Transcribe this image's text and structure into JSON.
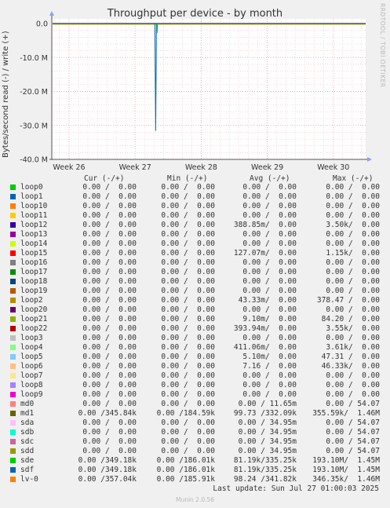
{
  "chart_data": {
    "type": "line",
    "title": "Throughput per device - by month",
    "ylabel": "Bytes/second read (-) / write (+)",
    "ylim": [
      -40000000,
      1000000
    ],
    "y_ticks": [
      {
        "value": 0,
        "label": "0.0"
      },
      {
        "value": -10000000,
        "label": "-10.0 M"
      },
      {
        "value": -20000000,
        "label": "-20.0 M"
      },
      {
        "value": -30000000,
        "label": "-30.0 M"
      },
      {
        "value": -40000000,
        "label": "-40.0 M"
      }
    ],
    "x_ticks": [
      "Week 26",
      "Week 27",
      "Week 28",
      "Week 29",
      "Week 30"
    ],
    "spike": {
      "week_pos": 2.0,
      "min_value": -31600000
    },
    "grid": true
  },
  "side_label": "RRDTOOL / TOBI OETIKER",
  "legend_headers": [
    "Cur (-/+)",
    "Min (-/+)",
    "Avg (-/+)",
    "Max (-/+)"
  ],
  "legend": [
    {
      "name": "loop0",
      "color": "#00cc00",
      "cur": "0.00 /  0.00",
      "min": "0.00 /  0.00",
      "avg": "0.00 /  0.00",
      "max": "0.00 /  0.00"
    },
    {
      "name": "loop1",
      "color": "#0066b3",
      "cur": "0.00 /  0.00",
      "min": "0.00 /  0.00",
      "avg": "0.00 /  0.00",
      "max": "0.00 /  0.00"
    },
    {
      "name": "loop10",
      "color": "#ff8000",
      "cur": "0.00 /  0.00",
      "min": "0.00 /  0.00",
      "avg": "0.00 /  0.00",
      "max": "0.00 /  0.00"
    },
    {
      "name": "loop11",
      "color": "#ffcc00",
      "cur": "0.00 /  0.00",
      "min": "0.00 /  0.00",
      "avg": "0.00 /  0.00",
      "max": "0.00 /  0.00"
    },
    {
      "name": "loop12",
      "color": "#330099",
      "cur": "0.00 /  0.00",
      "min": "0.00 /  0.00",
      "avg": "388.85m/  0.00",
      "max": "3.50k/  0.00"
    },
    {
      "name": "loop13",
      "color": "#990099",
      "cur": "0.00 /  0.00",
      "min": "0.00 /  0.00",
      "avg": "0.00 /  0.00",
      "max": "0.00 /  0.00"
    },
    {
      "name": "loop14",
      "color": "#ccff00",
      "cur": "0.00 /  0.00",
      "min": "0.00 /  0.00",
      "avg": "0.00 /  0.00",
      "max": "0.00 /  0.00"
    },
    {
      "name": "loop15",
      "color": "#ff0000",
      "cur": "0.00 /  0.00",
      "min": "0.00 /  0.00",
      "avg": "127.07m/  0.00",
      "max": "1.15k/  0.00"
    },
    {
      "name": "loop16",
      "color": "#808080",
      "cur": "0.00 /  0.00",
      "min": "0.00 /  0.00",
      "avg": "0.00 /  0.00",
      "max": "0.00 /  0.00"
    },
    {
      "name": "loop17",
      "color": "#008f00",
      "cur": "0.00 /  0.00",
      "min": "0.00 /  0.00",
      "avg": "0.00 /  0.00",
      "max": "0.00 /  0.00"
    },
    {
      "name": "loop18",
      "color": "#00487d",
      "cur": "0.00 /  0.00",
      "min": "0.00 /  0.00",
      "avg": "0.00 /  0.00",
      "max": "0.00 /  0.00"
    },
    {
      "name": "loop19",
      "color": "#b35a00",
      "cur": "0.00 /  0.00",
      "min": "0.00 /  0.00",
      "avg": "0.00 /  0.00",
      "max": "0.00 /  0.00"
    },
    {
      "name": "loop2",
      "color": "#b38f00",
      "cur": "0.00 /  0.00",
      "min": "0.00 /  0.00",
      "avg": "43.33m/  0.00",
      "max": "378.47 /  0.00"
    },
    {
      "name": "loop20",
      "color": "#6b006b",
      "cur": "0.00 /  0.00",
      "min": "0.00 /  0.00",
      "avg": "0.00 /  0.00",
      "max": "0.00 /  0.00"
    },
    {
      "name": "loop21",
      "color": "#8fb300",
      "cur": "0.00 /  0.00",
      "min": "0.00 /  0.00",
      "avg": "9.10m/  0.00",
      "max": "84.20 /  0.00"
    },
    {
      "name": "loop22",
      "color": "#b30000",
      "cur": "0.00 /  0.00",
      "min": "0.00 /  0.00",
      "avg": "393.94m/  0.00",
      "max": "3.55k/  0.00"
    },
    {
      "name": "loop3",
      "color": "#bebebe",
      "cur": "0.00 /  0.00",
      "min": "0.00 /  0.00",
      "avg": "0.00 /  0.00",
      "max": "0.00 /  0.00"
    },
    {
      "name": "loop4",
      "color": "#80ff80",
      "cur": "0.00 /  0.00",
      "min": "0.00 /  0.00",
      "avg": "411.06m/  0.00",
      "max": "3.61k/  0.00"
    },
    {
      "name": "loop5",
      "color": "#80c9ff",
      "cur": "0.00 /  0.00",
      "min": "0.00 /  0.00",
      "avg": "5.10m/  0.00",
      "max": "47.31 /  0.00"
    },
    {
      "name": "loop6",
      "color": "#ffc080",
      "cur": "0.00 /  0.00",
      "min": "0.00 /  0.00",
      "avg": "7.16 /  0.00",
      "max": "46.33k/  0.00"
    },
    {
      "name": "loop7",
      "color": "#ffe680",
      "cur": "0.00 /  0.00",
      "min": "0.00 /  0.00",
      "avg": "0.00 /  0.00",
      "max": "0.00 /  0.00"
    },
    {
      "name": "loop8",
      "color": "#aa80ff",
      "cur": "0.00 /  0.00",
      "min": "0.00 /  0.00",
      "avg": "0.00 /  0.00",
      "max": "0.00 /  0.00"
    },
    {
      "name": "loop9",
      "color": "#ee00cc",
      "cur": "0.00 /  0.00",
      "min": "0.00 /  0.00",
      "avg": "0.00 /  0.00",
      "max": "0.00 /  0.00"
    },
    {
      "name": "md0",
      "color": "#ff8080",
      "cur": "0.00 /  0.00",
      "min": "0.00 /  0.00",
      "avg": "0.00 / 11.65m",
      "max": "0.00 / 54.07"
    },
    {
      "name": "md1",
      "color": "#666600",
      "cur": "0.00 /345.84k",
      "min": "0.00 /184.59k",
      "avg": "99.73 /332.09k",
      "max": "355.59k/  1.46M"
    },
    {
      "name": "sda",
      "color": "#ffbfff",
      "cur": "0.00 /  0.00",
      "min": "0.00 /  0.00",
      "avg": "0.00 / 34.95m",
      "max": "0.00 / 54.07"
    },
    {
      "name": "sdb",
      "color": "#00ffcc",
      "cur": "0.00 /  0.00",
      "min": "0.00 /  0.00",
      "avg": "0.00 / 34.95m",
      "max": "0.00 / 54.07"
    },
    {
      "name": "sdc",
      "color": "#cc6699",
      "cur": "0.00 /  0.00",
      "min": "0.00 /  0.00",
      "avg": "0.00 / 34.95m",
      "max": "0.00 / 54.07"
    },
    {
      "name": "sdd",
      "color": "#999900",
      "cur": "0.00 /  0.00",
      "min": "0.00 /  0.00",
      "avg": "0.00 / 34.95m",
      "max": "0.00 / 54.07"
    },
    {
      "name": "sde",
      "color": "#00cc00",
      "cur": "0.00 /349.18k",
      "min": "0.00 /186.01k",
      "avg": "81.19k/335.25k",
      "max": "193.10M/  1.45M"
    },
    {
      "name": "sdf",
      "color": "#0066b3",
      "cur": "0.00 /349.18k",
      "min": "0.00 /186.01k",
      "avg": "81.19k/335.25k",
      "max": "193.10M/  1.45M"
    },
    {
      "name": "lv-0",
      "color": "#ff8000",
      "cur": "0.00 /357.04k",
      "min": "0.00 /185.91k",
      "avg": "98.24 /341.82k",
      "max": "346.35k/  1.46M"
    }
  ],
  "last_update": "Last update: Sun Jul 27 01:00:03 2025",
  "footer": "Munin 2.0.56"
}
